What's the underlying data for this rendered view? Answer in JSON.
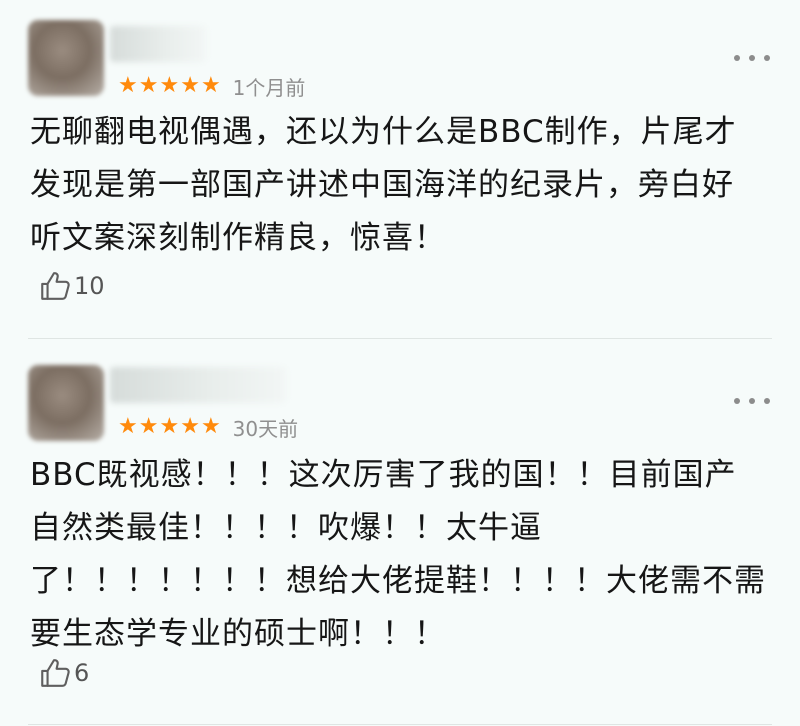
{
  "reviews": [
    {
      "rating_stars": 5,
      "time": "1个月前",
      "lines": [
        "无聊翻电视偶遇，还以为什么是BBC制作，片尾才",
        "发现是第一部国产讲述中国海洋的纪录片，旁白好",
        "听文案深刻制作精良，惊喜！"
      ],
      "likes": "10"
    },
    {
      "rating_stars": 5,
      "time": "30天前",
      "lines": [
        "BBC既视感！！！这次厉害了我的国！！目前国产",
        "自然类最佳！！！！吹爆！！太牛逼",
        "了！！！！！！！想给大佬提鞋！！！！大佬需不需",
        "要生态学专业的硕士啊！！！"
      ],
      "likes": "6"
    }
  ],
  "icons": {
    "star": "star-icon",
    "more": "more-icon",
    "like": "thumbs-up-icon"
  },
  "colors": {
    "star": "#ff8a0c",
    "background": "#f6fbfa"
  }
}
